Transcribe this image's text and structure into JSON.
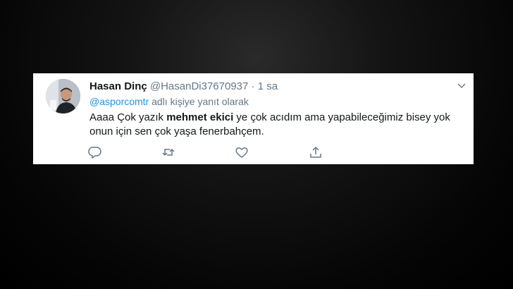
{
  "tweet": {
    "display_name": "Hasan Dinç",
    "handle": "@HasanDi37670937",
    "separator": "·",
    "timestamp": "1 sa",
    "reply_to_handle": "@asporcomtr",
    "reply_suffix": "adlı kişiye yanıt olarak",
    "text_part1": "Aaaa Çok yazık ",
    "text_bold": "mehmet ekici",
    "text_part2": " ye çok acıdım ama yapabileceğimiz bisey yok onun için sen çok yaşa fenerbahçem."
  },
  "icons": {
    "caret": "chevron-down-icon",
    "reply": "reply-icon",
    "retweet": "retweet-icon",
    "like": "heart-icon",
    "share": "share-icon"
  },
  "colors": {
    "background": "#000000",
    "card": "#ffffff",
    "name": "#14171a",
    "secondary": "#657786",
    "link": "#1b95e0"
  }
}
